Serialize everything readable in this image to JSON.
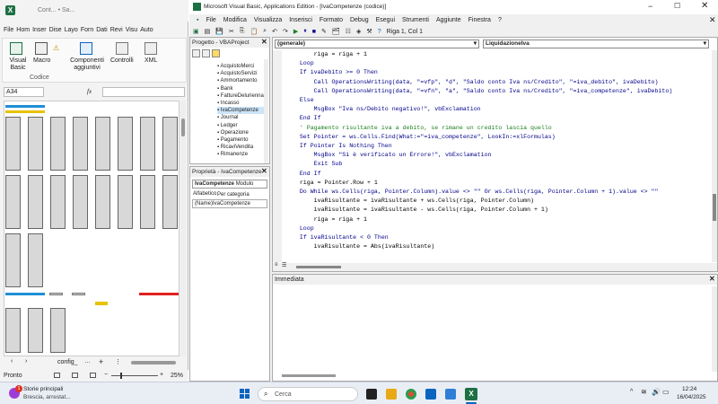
{
  "excel": {
    "title": "Cont... • Sa...",
    "ribbon_tabs": [
      "File",
      "Hom",
      "Inser",
      "Dise",
      "Layo",
      "Forn",
      "Dati",
      "Revi",
      "Visu",
      "Auto"
    ],
    "ribbon_buttons": {
      "visual_basic": "Visual Basic",
      "macro": "Macro",
      "components": "Componenti aggiuntivi",
      "controls": "Controlli",
      "xml": "XML"
    },
    "group_label": "Codice",
    "name_box": "A34",
    "fx": "fx",
    "sheet_tab": "config_",
    "status": "Pronto",
    "zoom": "25%"
  },
  "vbe": {
    "title": "Microsoft Visual Basic, Applications Edition - [IvaCompetenze (codice)]",
    "menu": [
      "File",
      "Modifica",
      "Visualizza",
      "Inserisci",
      "Formato",
      "Debug",
      "Esegui",
      "Strumenti",
      "Aggiunte",
      "Finestra",
      "?"
    ],
    "position": "Riga 1, Col 1",
    "project_title": "Progetto - VBAProject",
    "project_items": [
      "AcquistoMerci",
      "AcquistoServizi",
      "Ammortamento",
      "Bank",
      "FattureDeluriennali",
      "Incasso",
      "IvaCompetenze",
      "Journal",
      "Ledger",
      "Operazione",
      "Pagamento",
      "RicaviVendita",
      "Rimanenze"
    ],
    "props_title": "Proprietà - IvaCompetenze",
    "props_object": "IvaCompetenze",
    "props_type": "Modulo",
    "props_tabs": [
      "Alfabetico",
      "Per categoria"
    ],
    "props_name_key": "(Name)",
    "props_name_val": "IvaCompetenze",
    "combo_general": "(generale)",
    "combo_proc": "LiquidazioneIva",
    "immediate_title": "Immediata"
  },
  "code_lines": [
    "        riga = riga + 1",
    "    Loop",
    "",
    "    If ivaDebito >= 0 Then",
    "        Call OperationsWriting(data, \"=vfp\", \"d\", \"Saldo conto Iva ns/Credito\", \"=iva_debito\", ivaDebito)",
    "        Call OperationsWriting(data, \"=vfn\", \"a\", \"Saldo conto Iva ns/Credito\", \"=iva_competenze\", ivaDebito)",
    "    Else",
    "        MsgBox \"Iva ns/Debito negativo!\", vbExclamation",
    "    End If",
    "",
    "    ' Pagamento risultante iva a debito, se rimane un credito lascia quello",
    "",
    "    Set Pointer = ws.Cells.Find(What:=\"=iva_competenze\", LookIn:=xlFormulas)",
    "",
    "    If Pointer Is Nothing Then",
    "        MsgBox \"Si è verificato un Errore!\", vbExclamation",
    "        Exit Sub",
    "    End If",
    "",
    "    riga = Pointer.Row + 1",
    "    Do While ws.Cells(riga, Pointer.Column).value <> \"\" Or ws.Cells(riga, Pointer.Column + 1).value <> \"\"",
    "        ivaRisultante = ivaRisultante + ws.Cells(riga, Pointer.Column)",
    "        ivaRisultante = ivaRisultante - ws.Cells(riga, Pointer.Column + 1)",
    "        riga = riga + 1",
    "    Loop",
    "",
    "    If ivaRisultante < 0 Then",
    "        ivaRisultante = Abs(ivaRisultante)"
  ],
  "taskbar": {
    "news_title": "Storie principali",
    "news_sub": "Brescia, arrestat...",
    "search_placeholder": "Cerca",
    "time": "12:24",
    "date": "16/04/2025",
    "badge": "1"
  },
  "colors": {
    "accent": "#0b64c0",
    "excel_green": "#1d7044",
    "keyword": "#00008b",
    "comment": "#1a7f1a"
  }
}
